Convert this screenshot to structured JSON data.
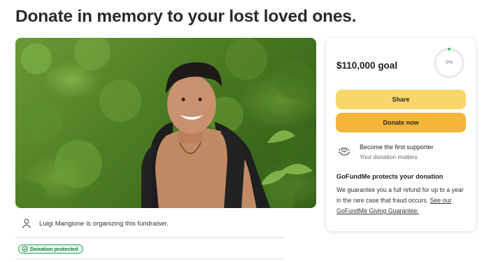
{
  "page": {
    "title": "Donate in memory to your lost loved ones."
  },
  "hero": {
    "image": "photo-of-smiling-man-with-backpack-in-jungle"
  },
  "organizer": {
    "icon": "person-icon",
    "text": "Luigi Mangione is organizing this fundraiser."
  },
  "badge": {
    "icon": "shield-icon",
    "label": "Donation protected",
    "color": "#27a35a"
  },
  "card": {
    "goal": "$110,000 goal",
    "progress_label": "0%",
    "progress_fraction": 0,
    "share_label": "Share",
    "donate_label": "Donate now",
    "share_color": "#f9d66a",
    "donate_color": "#f4b53a",
    "supporter_icon": "hands-heart-icon",
    "supporter_title": "Become the first supporter",
    "supporter_subtitle": "Your donation matters",
    "protect_title": "GoFundMe protects your donation",
    "protect_body": "We guarantee you a full refund for up to a year in the rare case that fraud occurs.",
    "protect_link": "See our GoFundMe Giving Guarantee."
  }
}
